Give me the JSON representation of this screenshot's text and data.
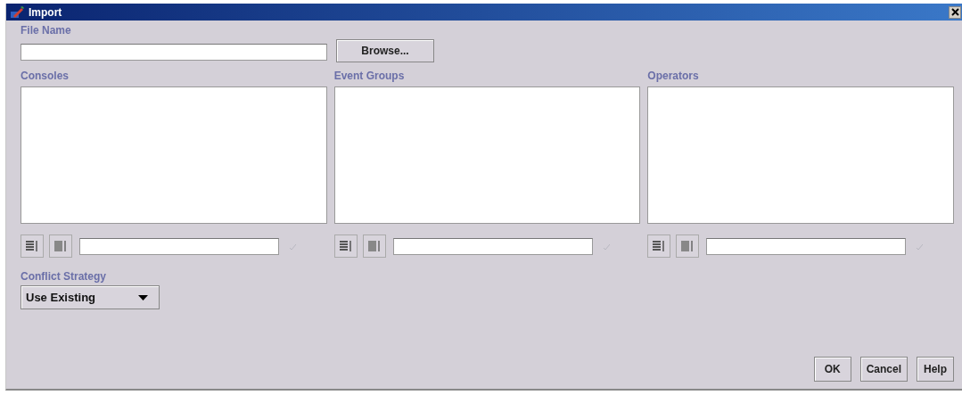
{
  "window": {
    "title": "Import"
  },
  "file_name": {
    "label": "File Name",
    "browse_button": "Browse..."
  },
  "lists": [
    {
      "label": "Consoles"
    },
    {
      "label": "Event Groups"
    },
    {
      "label": "Operators"
    }
  ],
  "conflict_strategy": {
    "label": "Conflict Strategy",
    "value": "Use Existing"
  },
  "buttons": [
    "OK",
    "Cancel",
    "Help"
  ]
}
